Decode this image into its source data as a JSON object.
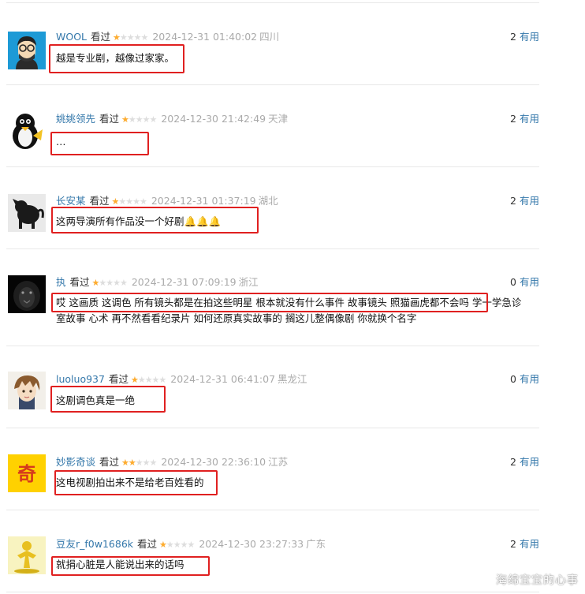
{
  "comments": [
    {
      "author": "WOOL",
      "watched": "看过",
      "rating": 1,
      "time": "2024-12-31 01:40:02",
      "location": "四川",
      "useful_count": "2",
      "useful_label": "有用",
      "avatar": "bearded-man-with-glasses",
      "text": "越是专业剧，越像过家家。"
    },
    {
      "author": "姚姚领先",
      "watched": "看过",
      "rating": 1,
      "time": "2024-12-30 21:42:49",
      "location": "天津",
      "useful_count": "2",
      "useful_label": "有用",
      "avatar": "penguin",
      "text": "…"
    },
    {
      "author": "长安某",
      "watched": "看过",
      "rating": 1,
      "time": "2024-12-31 01:37:19",
      "location": "湖北",
      "useful_count": "2",
      "useful_label": "有用",
      "avatar": "black-dog",
      "text": "这两导演所有作品没一个好剧🔔🔔🔔"
    },
    {
      "author": "执",
      "watched": "看过",
      "rating": 1,
      "time": "2024-12-31 07:09:19",
      "location": "浙江",
      "useful_count": "0",
      "useful_label": "有用",
      "avatar": "dark-lion",
      "text": "哎 这画质 这调色 所有镜头都是在拍这些明星 根本就没有什么事件 故事镜头 照猫画虎都不会吗 学一学急诊室故事 心术 再不然看看纪录片 如何还原真实故事的 搁这儿整偶像剧 你就换个名字"
    },
    {
      "author": "luoluo937",
      "watched": "看过",
      "rating": 1,
      "time": "2024-12-31 06:41:07",
      "location": "黑龙江",
      "useful_count": "0",
      "useful_label": "有用",
      "avatar": "anime-boy",
      "text": "这剧调色真是一绝"
    },
    {
      "author": "妙影奇谈",
      "watched": "看过",
      "rating": 2,
      "time": "2024-12-30 22:36:10",
      "location": "江苏",
      "useful_count": "2",
      "useful_label": "有用",
      "avatar": "yellow-badge-奇",
      "text": "这电视剧拍出来不是给老百姓看的"
    },
    {
      "author": "豆友r_f0w1686k",
      "watched": "看过",
      "rating": 1,
      "time": "2024-12-30 23:27:33",
      "location": "广东",
      "useful_count": "2",
      "useful_label": "有用",
      "avatar": "yellow-figure",
      "text": "就捐心脏是人能说出来的话吗"
    }
  ],
  "avatar_badge_char": "奇",
  "watermark": "海绵宝宝的心事",
  "colors": {
    "link": "#3377aa",
    "star": "#ffac2d",
    "highlight": "#e02020",
    "divider": "#e8e8e8"
  }
}
